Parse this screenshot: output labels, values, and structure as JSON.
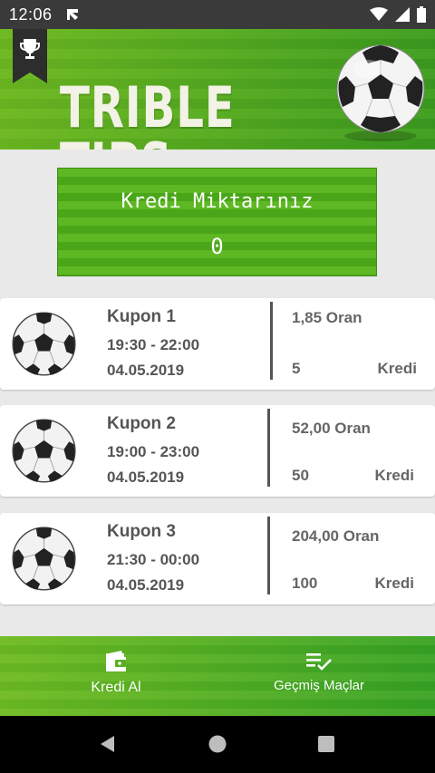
{
  "status_bar": {
    "time": "12:06"
  },
  "header": {
    "title": "TRIBLE TIPS"
  },
  "credit": {
    "label": "Kredi Miktarınız",
    "value": "0"
  },
  "coupons": [
    {
      "name": "Kupon 1",
      "time": "19:30 - 22:00",
      "date": "04.05.2019",
      "odds": "1,85 Oran",
      "credit_amount": "5",
      "credit_label": "Kredi"
    },
    {
      "name": "Kupon 2",
      "time": "19:00 - 23:00",
      "date": "04.05.2019",
      "odds": "52,00 Oran",
      "credit_amount": "50",
      "credit_label": "Kredi"
    },
    {
      "name": "Kupon 3",
      "time": "21:30 - 00:00",
      "date": "04.05.2019",
      "odds": "204,00 Oran",
      "credit_amount": "100",
      "credit_label": "Kredi"
    }
  ],
  "bottom_nav": {
    "buy_credit": "Kredi Al",
    "past_matches": "Geçmiş Maçlar"
  },
  "icons": {
    "trophy": "trophy-icon",
    "ball": "soccer-ball-icon",
    "wallet": "wallet-icon",
    "history": "playlist-check-icon"
  }
}
